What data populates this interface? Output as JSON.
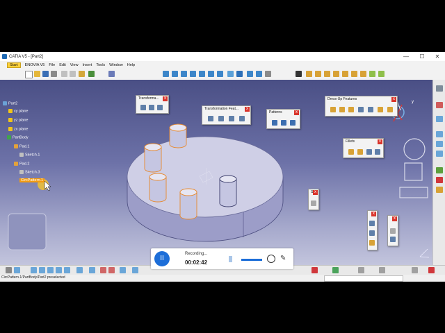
{
  "window": {
    "title": "CATIA V5 - [Part2]",
    "minimize": "—",
    "maximize": "☐",
    "close": "✕"
  },
  "menubar": [
    "Start",
    "ENOVIA V5",
    "File",
    "Edit",
    "View",
    "Insert",
    "Tools",
    "Window",
    "Help"
  ],
  "tree": {
    "root": "Part2",
    "items": [
      "xy plane",
      "yz plane",
      "zx plane",
      "PartBody",
      "Pad.1",
      "Sketch.1",
      "Pad.2",
      "Sketch.3",
      "CircPattern.1"
    ]
  },
  "panels": {
    "transformation": "Transforma...",
    "transformation_features": "Transformation Feat...",
    "patterns": "Patterns",
    "dressup": "Dress-Up Features",
    "fillets": "Fillets",
    "small": "S",
    "close": "x"
  },
  "axis": {
    "y": "y"
  },
  "recorder": {
    "status": "Recording...",
    "time": "00:02:42",
    "pause": "II"
  },
  "status_text": "CircPattern.1/PartBody/Part2 preselected",
  "colors": {
    "highlight": "#f39c12",
    "start_menu": "#ffd23b",
    "accent": "#1d6ed8"
  }
}
